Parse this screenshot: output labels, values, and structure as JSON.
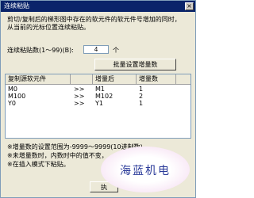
{
  "window": {
    "title": "连续粘贴",
    "close_glyph": "×"
  },
  "description": "剪切/复制后的梯形图中存在的软元件的软元件号增加的同时，\n从当前的光标位置连续粘贴。",
  "count": {
    "label": "连续粘贴数(1～99)(B):",
    "value": "4",
    "unit": "个"
  },
  "batch_button_label": "批量设置增量数",
  "table": {
    "headers": [
      "复制源软元件",
      "",
      "增量后",
      "增量数"
    ],
    "rows": [
      {
        "source": "M0",
        "arrow": ">>",
        "after": "M1",
        "increment": "1"
      },
      {
        "source": "M100",
        "arrow": ">>",
        "after": "M102",
        "increment": "2"
      },
      {
        "source": "Y0",
        "arrow": ">>",
        "after": "Y1",
        "increment": "1"
      }
    ]
  },
  "notes": [
    "※增量数的设置范围为-9999～9999(10进制数)",
    "※未增量数时，内数时中的值不变，",
    "※在插入模式下粘贴。"
  ],
  "ok_label": "执",
  "watermark": "海蓝机电"
}
